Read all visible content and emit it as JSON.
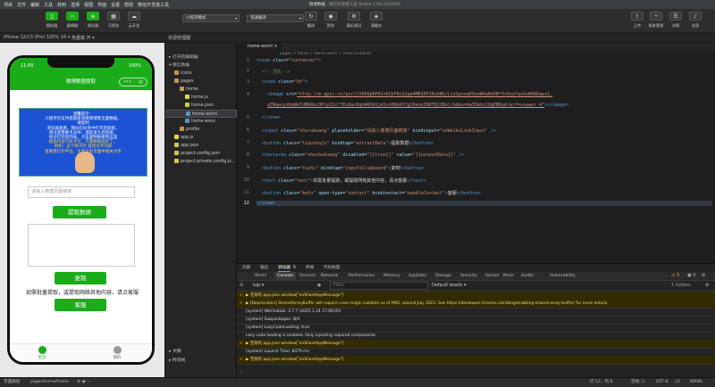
{
  "menu": {
    "items": [
      "项目",
      "文件",
      "编辑",
      "工具",
      "转到",
      "选择",
      "视图",
      "界面",
      "设置",
      "帮助",
      "微信开发者工具"
    ],
    "window_title_app": "微博数据",
    "window_title_rest": "· 微信开发者工具 Stable 1.06.2412050"
  },
  "toolbar": {
    "left": [
      {
        "label": "模拟器",
        "icon": "phone-icon"
      },
      {
        "label": "编辑器",
        "icon": "code-icon"
      },
      {
        "label": "调试器",
        "icon": "debug-icon"
      },
      {
        "label": "可视化",
        "icon": "visual-icon"
      },
      {
        "label": "云开发",
        "icon": "cloud-icon"
      }
    ],
    "mode_select": "小程序模式",
    "compile_select": "普通编译",
    "mid": [
      {
        "label": "编译",
        "icon": "refresh-icon"
      },
      {
        "label": "预览",
        "icon": "eye-icon"
      },
      {
        "label": "真机调试",
        "icon": "device-icon"
      },
      {
        "label": "清缓存",
        "icon": "clear-icon"
      }
    ],
    "right": [
      {
        "label": "上传",
        "icon": "upload-icon"
      },
      {
        "label": "版本管理",
        "icon": "version-icon"
      },
      {
        "label": "详情",
        "icon": "details-icon"
      },
      {
        "label": "消息",
        "icon": "bell-icon"
      }
    ]
  },
  "simulator": {
    "device": "iPhone 12/13 (Pro) 100% 16 ▾",
    "hotreload": "热重载 开 ▾",
    "time": "11:00",
    "battery": "100%",
    "title": "微博数据提取",
    "banner_lines": [
      "温馨提示：",
      "小程序仅支持提取新浪微博博客页面数据，",
      "请复制",
      "浏览器查看，网址在抖音中打开后链接，",
      "请注意需要点击中，放起发大后链接，",
      "经过打开您的站，点击复制链接到这里",
      "粘贴内容只有大写，只需数据就好了。",
      "例如：这个样子的 查找文字内容",
      "查看我们的平台，文字没有页面中相关文字"
    ],
    "input_placeholder": "请输入微博页面链接",
    "extract_button": "提取数据",
    "copy_button": "复制",
    "note": "如需批量提取，或提取网络其他内容，请点客服",
    "service_button": "客服",
    "tab_home": "主页",
    "tab_mine": "我的"
  },
  "tree": {
    "title": "资源管理器",
    "sections": [
      "打开的编辑器",
      "微信数据"
    ],
    "rows": [
      {
        "label": "icons",
        "color": "#c09553",
        "indent": 10
      },
      {
        "label": "pages",
        "color": "#c09553",
        "indent": 10
      },
      {
        "label": "home",
        "color": "#c09553",
        "indent": 16
      },
      {
        "label": "home.js",
        "color": "#e8d44d",
        "indent": 22
      },
      {
        "label": "home.json",
        "color": "#cbcb41",
        "indent": 22
      },
      {
        "label": "home.wxml",
        "color": "#519aba",
        "indent": 22
      },
      {
        "label": "home.wxss",
        "color": "#519aba",
        "indent": 22
      },
      {
        "label": "profile",
        "color": "#c09553",
        "indent": 16
      },
      {
        "label": "app.js",
        "color": "#e8d44d",
        "indent": 10
      },
      {
        "label": "app.json",
        "color": "#cbcb41",
        "indent": 10
      },
      {
        "label": "project.config.json",
        "color": "#cbcb41",
        "indent": 10
      },
      {
        "label": "project.private.config.js...",
        "color": "#cbcb41",
        "indent": 10
      }
    ],
    "outline": "大纲",
    "timeline": "时间线"
  },
  "editor": {
    "tab": "home.wxml",
    "crumb": "pages > home > home.wxml > view.container",
    "lines": [
      "1",
      "2",
      "3",
      "4",
      "5",
      "6",
      "7",
      "8",
      "9",
      "10",
      "11",
      "12"
    ]
  },
  "devtools": {
    "tabs": [
      "问题",
      "输出",
      "调试器",
      "终端",
      "代码质量"
    ],
    "active_tab_badge": "5",
    "ctabs": [
      "Wxml",
      "Console",
      "Sources",
      "Network",
      "Performance",
      "Memory",
      "AppData",
      "Storage",
      "Security",
      "Sensor",
      "Mock",
      "Audits",
      "Vulnerability"
    ],
    "filter_top": "top",
    "filter_placeholder": "Filter",
    "levels": "Default levels ▾",
    "hidden": "1 hidden",
    "warn_count": "5",
    "info_count": "5",
    "logs": [
      {
        "type": "warn",
        "text": "▶ 无效的 app.json window[\"onShareAppMessage\"]"
      },
      {
        "type": "warn",
        "text": "▶ [Deprecation] SharedArrayBuffer will require cross-origin isolation as of M92, around July 2021. See https://developer.chrome.com/blog/enabling-shared-array-buffer/ for more details."
      },
      {
        "type": "info",
        "text": "[system] WeChatLib: 3.7.7 (2025.1.24 17:06:05)"
      },
      {
        "type": "info",
        "text": "[system] Subpackages: N/A"
      },
      {
        "type": "info",
        "text": "[system] LazyCodeLoading: true"
      },
      {
        "type": "info",
        "text": "Lazy code loading is enabled. Only injecting required components."
      },
      {
        "type": "warn",
        "text": "▶ 无效的 app.json window[\"onShareAppMessage\"]"
      },
      {
        "type": "info",
        "text": "[system] Launch Time: 8479 ms"
      },
      {
        "type": "warn",
        "text": "▶ 无效的 app.json window[\"onShareAppMessage\"]"
      }
    ]
  },
  "statusbar": {
    "path_label": "页面路径",
    "path": "pages/home/home",
    "pos": "行 12，列 8",
    "spaces": "空格: 2",
    "enc": "UTF-8",
    "eol": "LF",
    "lang": "WXML"
  }
}
